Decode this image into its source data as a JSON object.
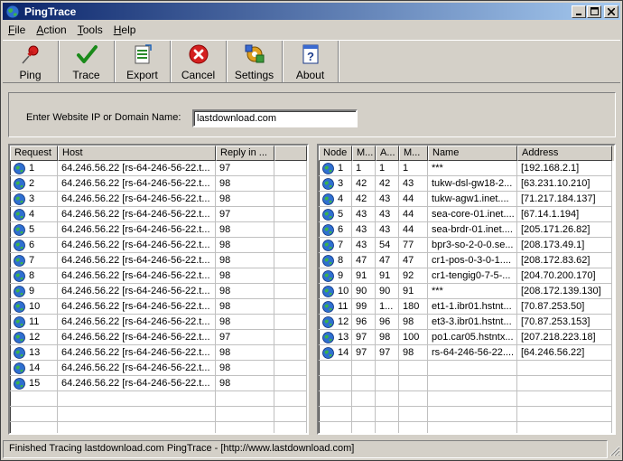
{
  "window": {
    "title": "PingTrace"
  },
  "menu": [
    {
      "label": "File",
      "key": "F",
      "rest": "ile"
    },
    {
      "label": "Action",
      "key": "A",
      "rest": "ction"
    },
    {
      "label": "Tools",
      "key": "T",
      "rest": "ools"
    },
    {
      "label": "Help",
      "key": "H",
      "rest": "elp"
    }
  ],
  "toolbar": {
    "ping": "Ping",
    "trace": "Trace",
    "export": "Export",
    "cancel": "Cancel",
    "settings": "Settings",
    "about": "About"
  },
  "input": {
    "label": "Enter Website IP or Domain Name:",
    "value": "lastdownload.com"
  },
  "ping_table": {
    "columns": [
      "Request",
      "Host",
      "Reply in ..."
    ],
    "rows": [
      [
        "1",
        "64.246.56.22 [rs-64-246-56-22.t...",
        "97"
      ],
      [
        "2",
        "64.246.56.22 [rs-64-246-56-22.t...",
        "98"
      ],
      [
        "3",
        "64.246.56.22 [rs-64-246-56-22.t...",
        "98"
      ],
      [
        "4",
        "64.246.56.22 [rs-64-246-56-22.t...",
        "97"
      ],
      [
        "5",
        "64.246.56.22 [rs-64-246-56-22.t...",
        "98"
      ],
      [
        "6",
        "64.246.56.22 [rs-64-246-56-22.t...",
        "98"
      ],
      [
        "7",
        "64.246.56.22 [rs-64-246-56-22.t...",
        "98"
      ],
      [
        "8",
        "64.246.56.22 [rs-64-246-56-22.t...",
        "98"
      ],
      [
        "9",
        "64.246.56.22 [rs-64-246-56-22.t...",
        "98"
      ],
      [
        "10",
        "64.246.56.22 [rs-64-246-56-22.t...",
        "98"
      ],
      [
        "11",
        "64.246.56.22 [rs-64-246-56-22.t...",
        "98"
      ],
      [
        "12",
        "64.246.56.22 [rs-64-246-56-22.t...",
        "97"
      ],
      [
        "13",
        "64.246.56.22 [rs-64-246-56-22.t...",
        "98"
      ],
      [
        "14",
        "64.246.56.22 [rs-64-246-56-22.t...",
        "98"
      ],
      [
        "15",
        "64.246.56.22 [rs-64-246-56-22.t...",
        "98"
      ]
    ]
  },
  "trace_table": {
    "columns": [
      "Node",
      "M...",
      "A...",
      "M...",
      "Name",
      "Address"
    ],
    "rows": [
      [
        "1",
        "1",
        "1",
        "1",
        "***",
        "[192.168.2.1]"
      ],
      [
        "3",
        "42",
        "42",
        "43",
        "tukw-dsl-gw18-2...",
        "[63.231.10.210]"
      ],
      [
        "4",
        "42",
        "43",
        "44",
        "tukw-agw1.inet....",
        "[71.217.184.137]"
      ],
      [
        "5",
        "43",
        "43",
        "44",
        "sea-core-01.inet....",
        "[67.14.1.194]"
      ],
      [
        "6",
        "43",
        "43",
        "44",
        "sea-brdr-01.inet....",
        "[205.171.26.82]"
      ],
      [
        "7",
        "43",
        "54",
        "77",
        "bpr3-so-2-0-0.se...",
        "[208.173.49.1]"
      ],
      [
        "8",
        "47",
        "47",
        "47",
        "cr1-pos-0-3-0-1....",
        "[208.172.83.62]"
      ],
      [
        "9",
        "91",
        "91",
        "92",
        "cr1-tengig0-7-5-...",
        "[204.70.200.170]"
      ],
      [
        "10",
        "90",
        "90",
        "91",
        "***",
        "[208.172.139.130]"
      ],
      [
        "11",
        "99",
        "1...",
        "180",
        "et1-1.ibr01.hstnt...",
        "[70.87.253.50]"
      ],
      [
        "12",
        "96",
        "96",
        "98",
        "et3-3.ibr01.hstnt...",
        "[70.87.253.153]"
      ],
      [
        "13",
        "97",
        "98",
        "100",
        "po1.car05.hstntx...",
        "[207.218.223.18]"
      ],
      [
        "14",
        "97",
        "97",
        "98",
        "rs-64-246-56-22....",
        "[64.246.56.22]"
      ]
    ]
  },
  "status": {
    "text": "Finished Tracing lastdownload.com PingTrace -  [http://www.lastdownload.com]"
  },
  "colors": {
    "title_start": "#0a246a",
    "title_end": "#a6caf0",
    "face": "#d4d0c8"
  },
  "icons": {
    "ping": "pushpin-icon",
    "trace": "checkmark-icon",
    "export": "spreadsheet-export-icon",
    "cancel": "red-x-icon",
    "settings": "gear-puzzle-icon",
    "about": "help-question-icon",
    "row": "globe-icon"
  }
}
